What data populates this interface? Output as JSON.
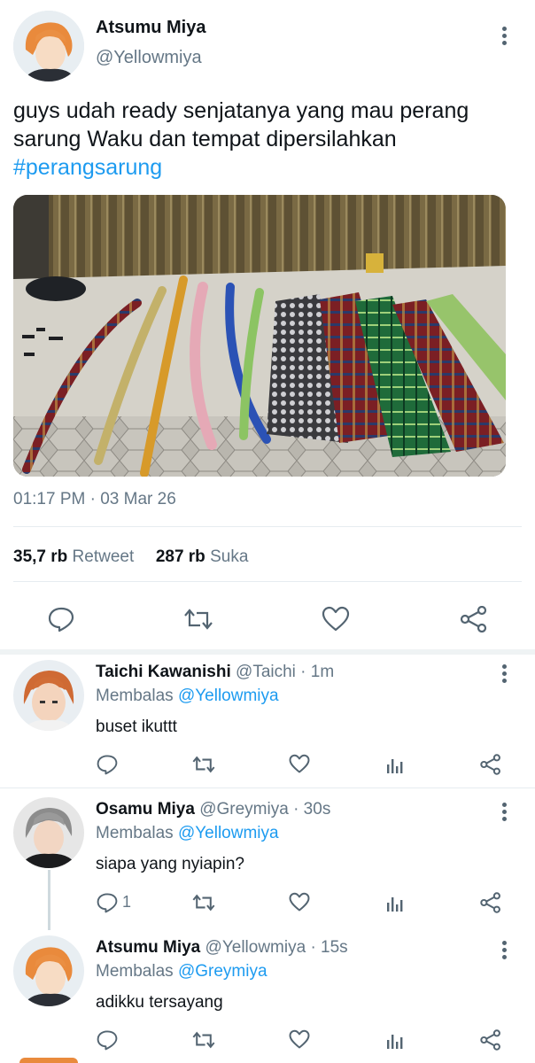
{
  "main_tweet": {
    "display_name": "Atsumu Miya",
    "handle": "@Yellowmiya",
    "text_line1": "guys udah ready senjatanya yang mau perang",
    "text_line2": "sarung Waku dan tempat dipersilahkan",
    "hashtag": "#perangsarung",
    "time": "01:17 PM",
    "dot": "·",
    "date": "03 Mar 26",
    "retweet_count": "35,7 rb",
    "retweet_label": "Retweet",
    "like_count": "287 rb",
    "like_label": "Suka"
  },
  "replies": [
    {
      "display_name": "Taichi Kawanishi",
      "handle_time": "@Taichi · 1m",
      "reply_prefix": "Membalas",
      "reply_to": "@Yellowmiya",
      "text": "buset ikuttt",
      "reply_count": ""
    },
    {
      "display_name": "Osamu Miya",
      "handle_time": "@Greymiya · 30s",
      "reply_prefix": "Membalas",
      "reply_to": "@Yellowmiya",
      "text": "siapa yang nyiapin?",
      "reply_count": "1"
    },
    {
      "display_name": "Atsumu Miya",
      "handle_time": "@Yellowmiya · 15s",
      "reply_prefix": "Membalas",
      "reply_to": "@Greymiya",
      "text": "adikku tersayang",
      "reply_count": ""
    }
  ],
  "colors": {
    "link": "#1d9bf0",
    "muted": "#657786",
    "icon": "#536471",
    "divider": "#e6ecf0"
  },
  "icons": [
    "more-icon",
    "reply-icon",
    "retweet-icon",
    "like-icon",
    "share-icon",
    "analytics-icon"
  ]
}
